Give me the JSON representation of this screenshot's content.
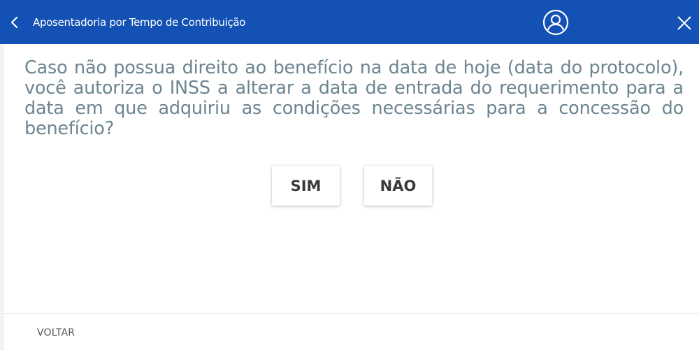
{
  "header": {
    "title": "Aposentadoria por Tempo de Contribuição",
    "back_icon": "chevron-left-icon",
    "user_icon": "user-circle-icon",
    "close_icon": "close-icon",
    "background_color": "#1351b4"
  },
  "main": {
    "question": "Caso não possua direito ao benefício na data de hoje (data do protocolo), você autoriza o INSS a alterar a data de entrada do requerimento para a data em que adquiriu as condições necessárias para a concessão do benefício?",
    "yes_label": "SIM",
    "no_label": "NÃO",
    "question_color": "#6c8591"
  },
  "footer": {
    "back_label": "VOLTAR"
  }
}
